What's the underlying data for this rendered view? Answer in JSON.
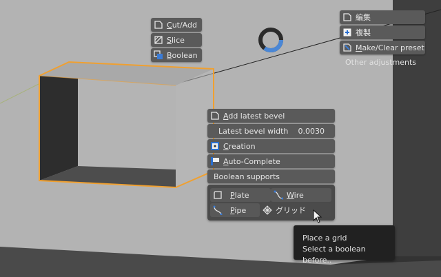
{
  "viewport": {
    "background_color": "#b4b4b4",
    "wall_color": "#3a3a3a",
    "selection_color": "#f0a030",
    "progress_indicator_fraction": 0.35
  },
  "tool_menu": {
    "cut_add": {
      "label": "Cut/Add",
      "icon": "cut-add-icon"
    },
    "slice": {
      "label": "Slice",
      "icon": "slice-icon"
    },
    "boolean": {
      "label": "Boolean",
      "icon": "boolean-icon"
    }
  },
  "top_right_menu": {
    "edit": {
      "label": "編集",
      "icon": "edit-icon"
    },
    "duplicate": {
      "label": "複製",
      "icon": "duplicate-icon"
    },
    "make_clear_preset": {
      "label": "Make/Clear preset",
      "icon": "preset-icon"
    },
    "other_adjustments": "Other adjustments"
  },
  "bevel_panel": {
    "add_latest_bevel": "Add latest bevel",
    "latest_bevel_width_label": "Latest bevel width",
    "latest_bevel_width_value": "0.0030",
    "creation": "Creation",
    "auto_complete": "Auto-Complete",
    "boolean_supports": "Boolean supports"
  },
  "supports": {
    "plate": "Plate",
    "wire": "Wire",
    "pipe": "Pipe",
    "grid": "グリッド"
  },
  "tooltip": {
    "line1": "Place a grid",
    "line2": "Select a boolean before.."
  }
}
